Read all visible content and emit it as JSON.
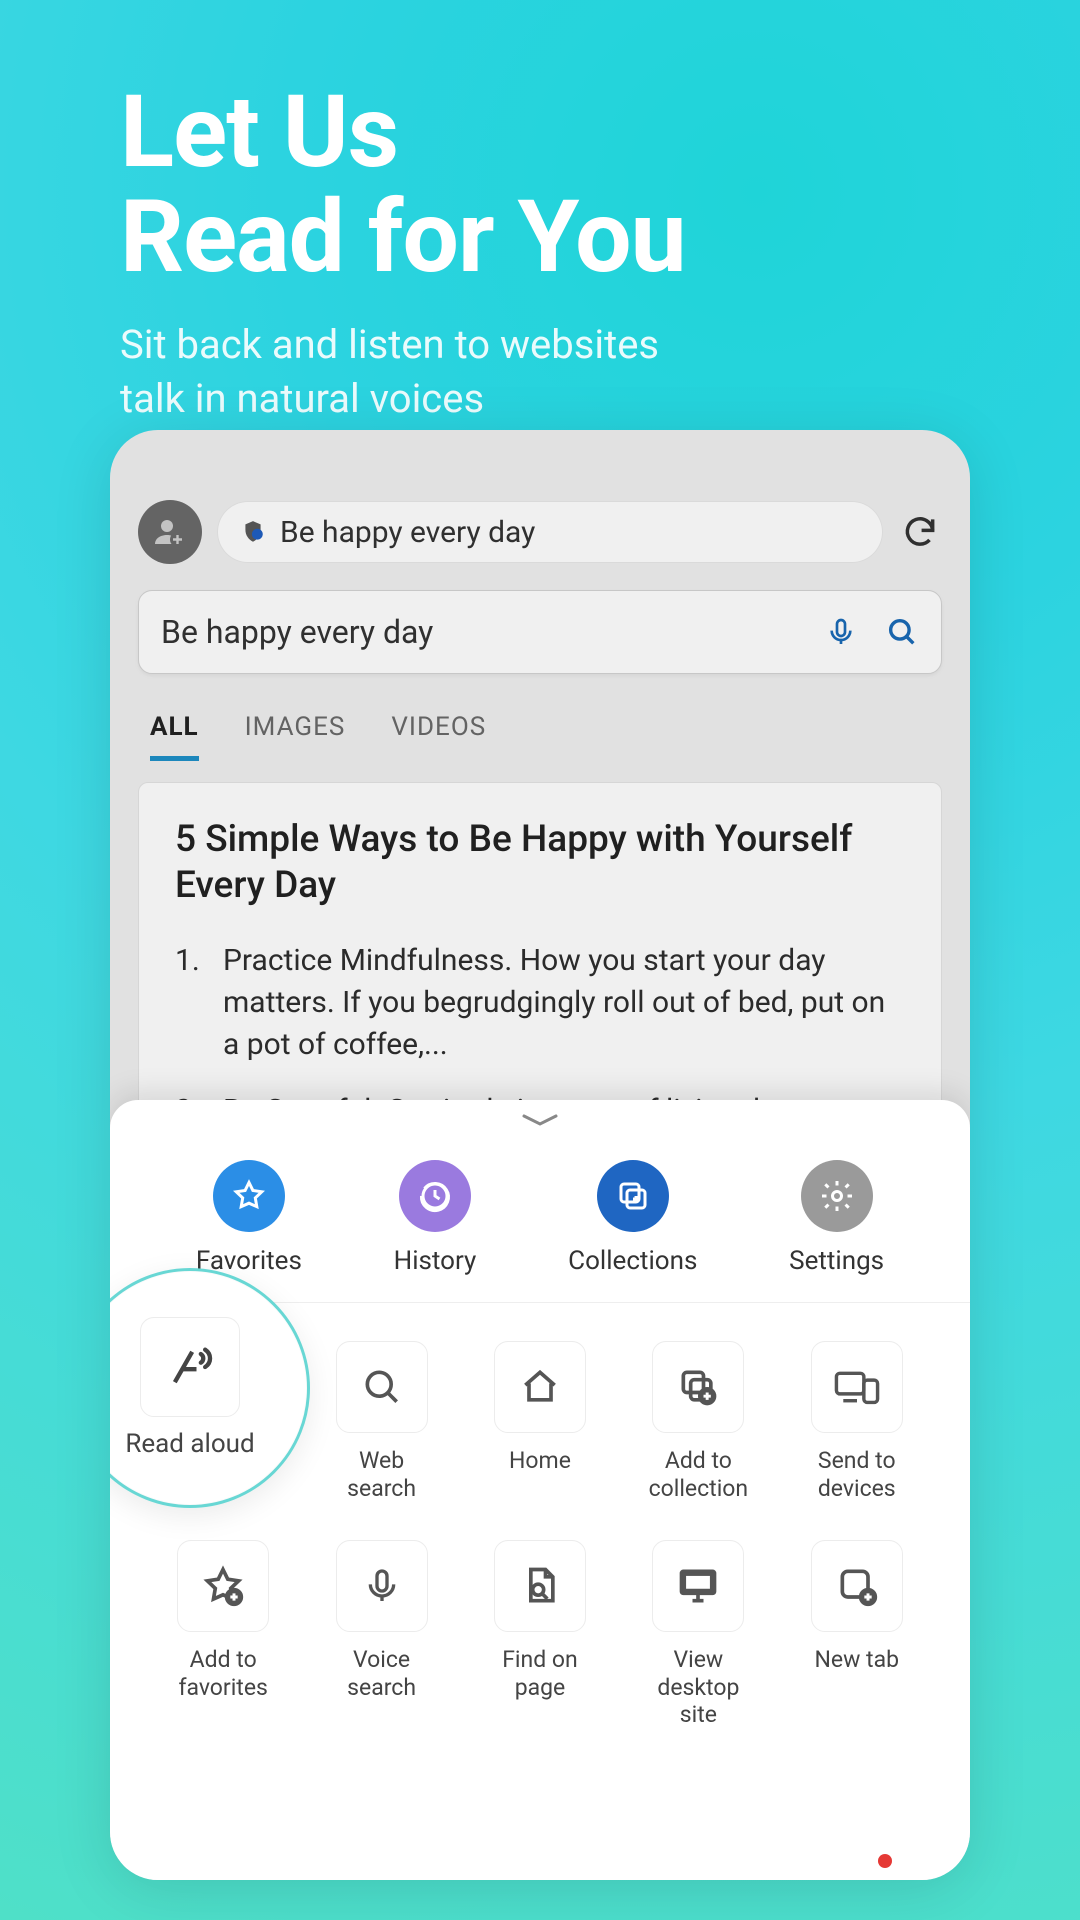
{
  "hero": {
    "title_line1": "Let Us",
    "title_line2": "Read for You",
    "subtitle_line1": "Sit back and listen to websites",
    "subtitle_line2": "talk in natural voices"
  },
  "browser": {
    "address_text": "Be happy every day",
    "search_text": "Be happy every day",
    "tabs": {
      "all": "ALL",
      "images": "IMAGES",
      "videos": "VIDEOS"
    },
    "result": {
      "title": "5 Simple Ways to Be Happy with Yourself Every Day",
      "item1": "Practice Mindfulness. How you start your day matters. If you begrudgingly roll out of bed, put on a pot of coffee,...",
      "item2": "Be Grateful. Gratitude is a way of living that focuses on seeing the good, no matter how"
    }
  },
  "sheet": {
    "quick": {
      "favorites": "Favorites",
      "history": "History",
      "collections": "Collections",
      "settings": "Settings"
    },
    "tools": {
      "read_aloud": "Read aloud",
      "web_search": "Web search",
      "home": "Home",
      "add_collection": "Add to collection",
      "send_devices": "Send to devices",
      "add_favorites": "Add to favorites",
      "voice_search": "Voice search",
      "find_page": "Find on page",
      "desktop_site": "View desktop site",
      "new_tab": "New tab"
    }
  }
}
